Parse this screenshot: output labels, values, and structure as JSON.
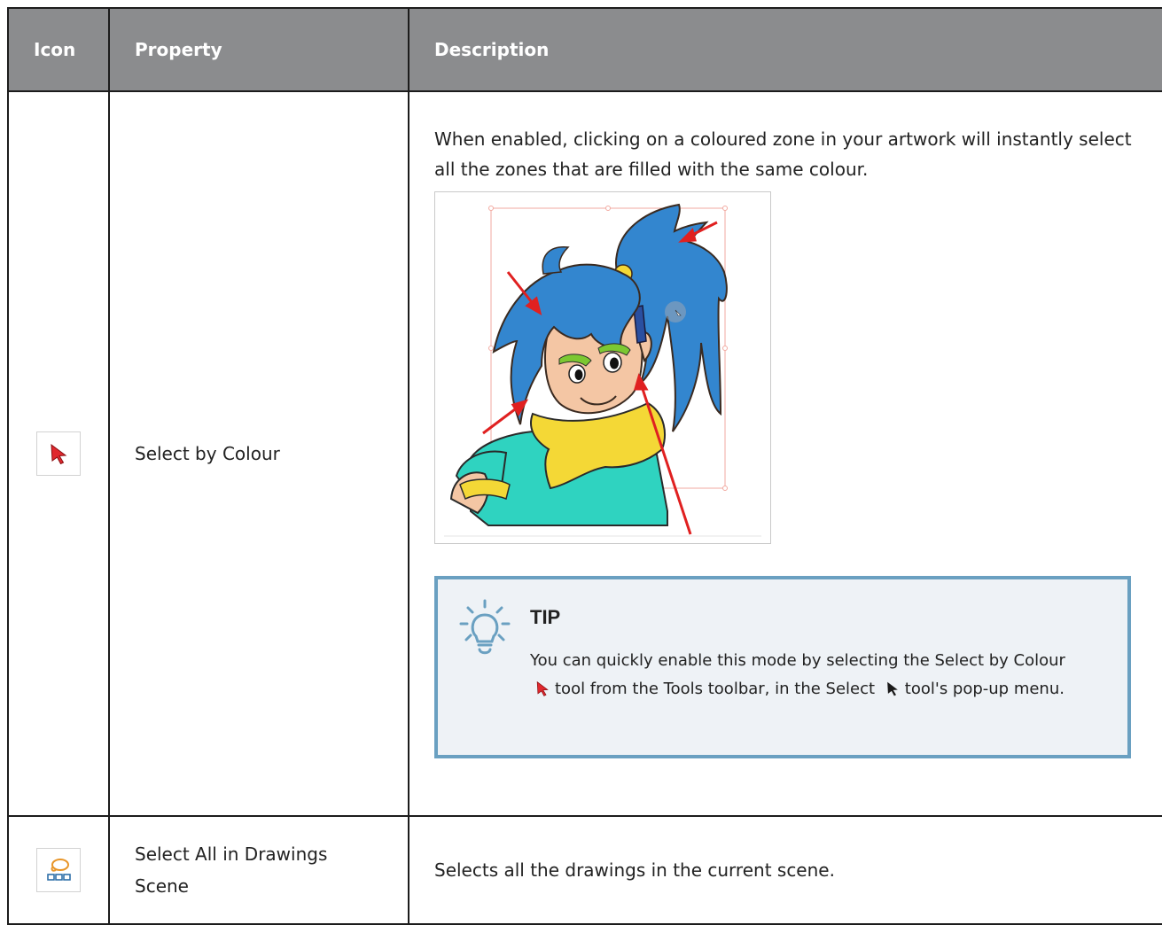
{
  "table": {
    "headers": {
      "icon": "Icon",
      "property": "Property",
      "description": "Description"
    },
    "rows": [
      {
        "icon": "select-by-colour-icon",
        "property": "Select by Colour",
        "description": "When enabled, clicking on a coloured zone in your artwork will instantly select all the zones that are filled with the same colour.",
        "tip": {
          "title": "TIP",
          "text_before": "You can quickly enable this mode by selecting the Select by Colour",
          "text_middle": "tool from the Tools toolbar, in the Select",
          "text_after": "tool's pop-up menu."
        }
      },
      {
        "icon": "select-all-drawings-icon",
        "property": "Select All in Drawings Scene",
        "description": "Selects all the drawings in the current scene."
      }
    ]
  },
  "colors": {
    "header_bg": "#8b8c8e",
    "tip_border": "#6aa0c1",
    "tip_bg": "#eef2f6",
    "hair": "#3386cf"
  }
}
